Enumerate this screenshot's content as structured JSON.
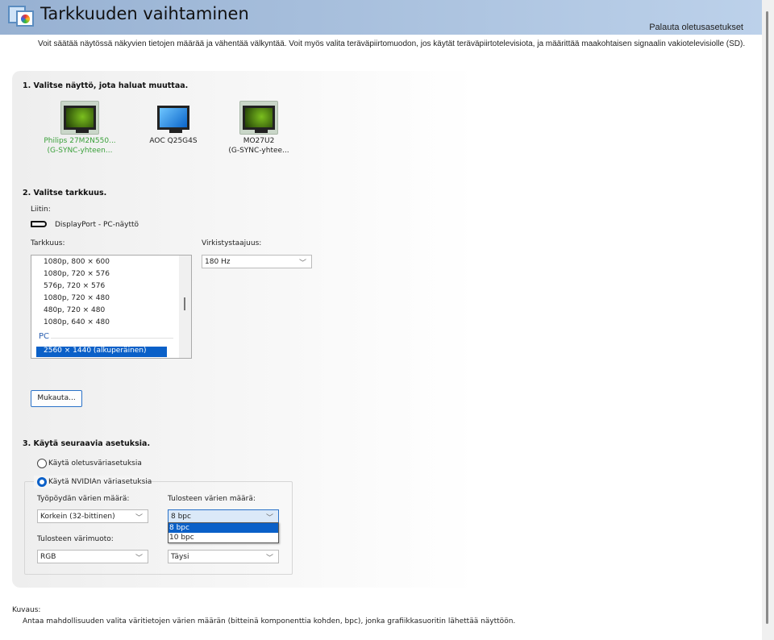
{
  "header": {
    "title": "Tarkkuuden vaihtaminen",
    "restore_defaults": "Palauta oletusasetukset"
  },
  "intro": "Voit säätää näytössä näkyvien tietojen määrää ja vähentää välkyntää. Voit myös valita teräväpiirtomuodon, jos käytät teräväpiirtotelevisiota, ja määrittää maakohtaisen signaalin vakiotelevisiolle (SD).",
  "step1": {
    "heading": "1. Valitse näyttö, jota haluat muuttaa.",
    "monitors": [
      {
        "name": "Philips 27M2N550...",
        "sub": "(G-SYNC-yhteen...",
        "selected": true
      },
      {
        "name": "AOC Q25G4S",
        "sub": ""
      },
      {
        "name": "MO27U2",
        "sub": "(G-SYNC-yhtee..."
      }
    ]
  },
  "step2": {
    "heading": "2. Valitse tarkkuus.",
    "connector_label": "Liitin:",
    "connector": "DisplayPort - PC-näyttö",
    "resolution_label": "Tarkkuus:",
    "resolutions": [
      "1080p, 800 × 600",
      "1080p, 720 × 576",
      "576p, 720 × 576",
      "1080p, 720 × 480",
      "480p, 720 × 480",
      "1080p, 640 × 480"
    ],
    "group_pc": "PC",
    "selected_resolution": "2560 × 1440 (alkuperäinen)",
    "refresh_label": "Virkistystaajuus:",
    "refresh_value": "180 Hz",
    "customize": "Mukauta..."
  },
  "step3": {
    "heading": "3. Käytä seuraavia asetuksia.",
    "radio_default": "Käytä oletusväriasetuksia",
    "radio_nvidia": "Käytä NVIDIAn väriasetuksia",
    "desktop_depth_label": "Työpöydän värien määrä:",
    "desktop_depth": "Korkein (32-bittinen)",
    "output_depth_label": "Tulosteen värien määrä:",
    "output_depth": "8 bpc",
    "output_depth_options": [
      "8 bpc",
      "10 bpc"
    ],
    "color_format_label": "Tulosteen värimuoto:",
    "color_format": "RGB",
    "dynamic_range": "Täysi"
  },
  "description": {
    "label": "Kuvaus:",
    "text": "Antaa mahdollisuuden valita väritietojen värien määrän (bitteinä komponenttia kohden, bpc), jonka grafiikkasuoritin lähettää näyttöön."
  },
  "colors": {
    "accent": "#0a60c8",
    "selected_monitor_text": "#3aa03a"
  }
}
